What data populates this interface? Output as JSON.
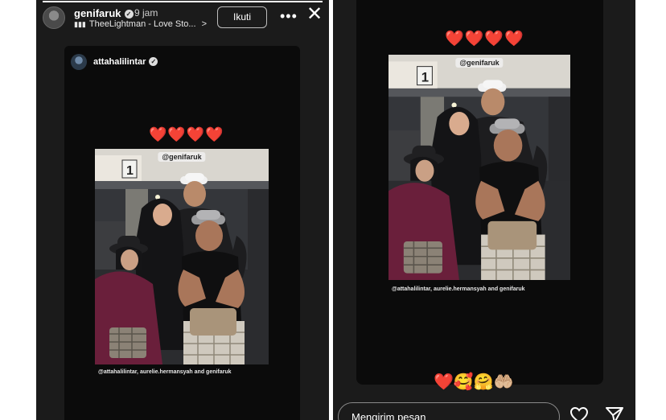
{
  "left": {
    "header": {
      "username": "genifaruk",
      "time": "9 jam",
      "music": "TheeLightman - Love Sto...",
      "music_arrow": ">",
      "follow_label": "Ikuti",
      "more_icon": "more-horizontal-icon",
      "close_icon": "close-icon"
    },
    "card": {
      "username": "attahalilintar",
      "hearts": "❤️❤️❤️❤️",
      "photo_tag": "@genifaruk",
      "tagged": "@attahalilintar, aurelie.hermansyah and genifaruk"
    }
  },
  "right": {
    "card": {
      "hearts": "❤️❤️❤️❤️",
      "photo_tag": "@genifaruk",
      "tagged": "@attahalilintar, aurelie.hermansyah and genifaruk"
    },
    "reactions": "❤️🥰🤗🤲🏼",
    "message_placeholder": "Mengirim pesan",
    "heart_icon": "heart-outline-icon",
    "send_icon": "send-icon"
  },
  "colors": {
    "background": "#1b1b1b",
    "card": "#0b0b0b",
    "heart": "#e2242b"
  }
}
